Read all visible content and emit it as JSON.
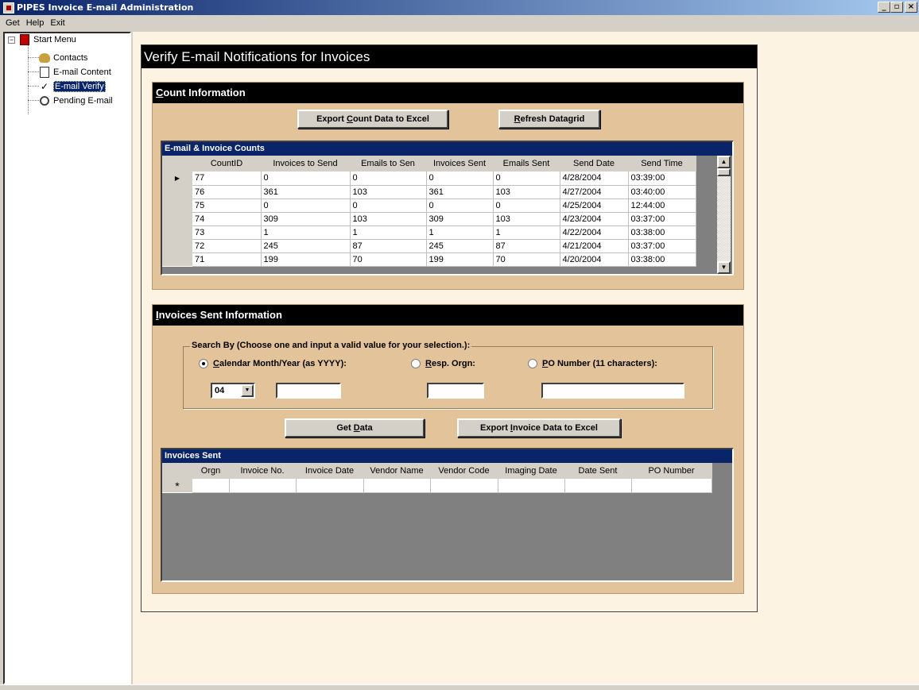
{
  "window": {
    "title": "PIPES Invoice E-mail Administration",
    "btn_min": "_",
    "btn_max": "▫",
    "btn_close": "×"
  },
  "menu": [
    "Get",
    "Help",
    "Exit"
  ],
  "tree": {
    "root": "Start Menu",
    "items": [
      "Contacts",
      "E-mail Content",
      "E-mail Verify",
      "Pending E-mail"
    ],
    "selected_index": 2
  },
  "form": {
    "title": "Verify E-mail Notifications for Invoices",
    "count_section": {
      "heading_underlined": "C",
      "heading_rest": "ount Information",
      "export_btn": {
        "pre": "Export ",
        "u": "C",
        "post": "ount Data to Excel"
      },
      "refresh_btn": {
        "pre": "",
        "u": "R",
        "post": "efresh Datagrid"
      },
      "grid": {
        "caption": "E-mail & Invoice Counts",
        "columns": [
          "CountID",
          "Invoices to Send",
          "Emails to Sen",
          "Invoices Sent",
          "Emails Sent",
          "Send Date",
          "Send Time"
        ],
        "rows": [
          [
            "77",
            "0",
            "0",
            "0",
            "0",
            "4/28/2004",
            "03:39:00"
          ],
          [
            "76",
            "361",
            "103",
            "361",
            "103",
            "4/27/2004",
            "03:40:00"
          ],
          [
            "75",
            "0",
            "0",
            "0",
            "0",
            "4/25/2004",
            "12:44:00"
          ],
          [
            "74",
            "309",
            "103",
            "309",
            "103",
            "4/23/2004",
            "03:37:00"
          ],
          [
            "73",
            "1",
            "1",
            "1",
            "1",
            "4/22/2004",
            "03:38:00"
          ],
          [
            "72",
            "245",
            "87",
            "245",
            "87",
            "4/21/2004",
            "03:37:00"
          ],
          [
            "71",
            "199",
            "70",
            "199",
            "70",
            "4/20/2004",
            "03:38:00"
          ]
        ],
        "current_row_marker": "▶"
      }
    },
    "invoice_section": {
      "heading_underlined": "I",
      "heading_rest": "nvoices Sent Information",
      "search": {
        "legend": "Search By (Choose one and input a valid value for your selection.):",
        "radios": [
          {
            "pre": "",
            "u": "C",
            "post": "alendar Month/Year (as YYYY):",
            "checked": true
          },
          {
            "pre": "",
            "u": "R",
            "post": "esp. Orgn:",
            "checked": false
          },
          {
            "pre": "",
            "u": "P",
            "post": "O Number (11 characters):",
            "checked": false
          }
        ],
        "month_value": "04",
        "year_value": "",
        "orgn_value": "",
        "po_value": ""
      },
      "get_btn": {
        "pre": "Get ",
        "u": "D",
        "post": "ata"
      },
      "export_btn": {
        "pre": "Export ",
        "u": "I",
        "post": "nvoice Data to Excel"
      },
      "grid": {
        "caption": "Invoices Sent",
        "columns": [
          "Orgn",
          "Invoice No.",
          "Invoice Date",
          "Vendor Name",
          "Vendor Code",
          "Imaging Date",
          "Date Sent",
          "PO Number"
        ],
        "new_row_marker": "*"
      }
    }
  }
}
